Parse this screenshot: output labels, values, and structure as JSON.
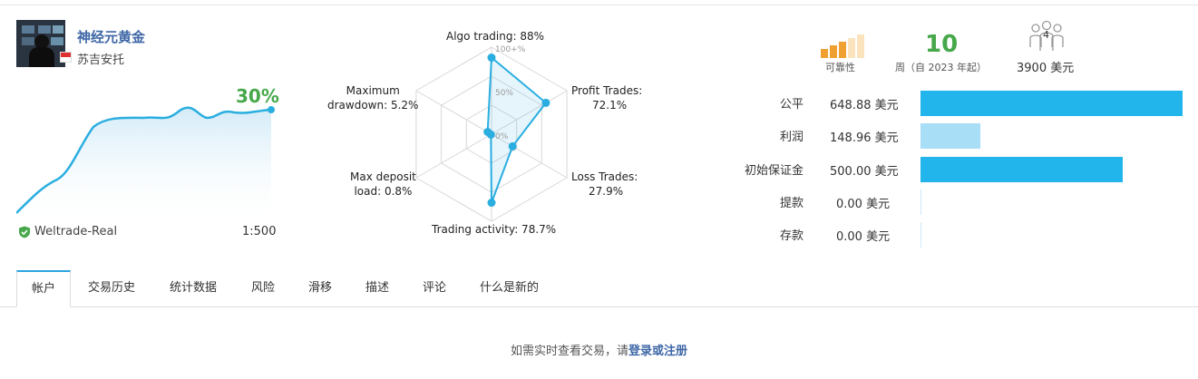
{
  "signal": {
    "name": "神经元黄金",
    "author": "苏吉安托",
    "growth": "30%",
    "broker": "Weltrade-Real",
    "leverage": "1:500"
  },
  "radar": {
    "algo_trading": "Algo trading: 88%",
    "profit_trades_line1": "Profit Trades:",
    "profit_trades_line2": "72.1%",
    "loss_trades_line1": "Loss Trades:",
    "loss_trades_line2": "27.9%",
    "trading_activity": "Trading activity: 78.7%",
    "max_deposit_line1": "Max deposit",
    "max_deposit_line2": "load: 0.8%",
    "max_drawdown_line1": "Maximum",
    "max_drawdown_line2": "drawdown: 5.2%",
    "scale_100": "100+%",
    "scale_50": "50%",
    "scale_0": "0%",
    "values": {
      "algo_trading": 88,
      "profit_trades": 72.1,
      "loss_trades": 27.9,
      "trading_activity": 78.7,
      "max_deposit_load": 0.8,
      "max_drawdown": 5.2
    }
  },
  "stats": {
    "reliability_label": "可靠性",
    "weeks_value": "10",
    "weeks_label": "周（自 2023 年起）",
    "subscribers": "4",
    "price": "3900 美元"
  },
  "finance": [
    {
      "label": "公平",
      "value": "648.88 美元",
      "fill": 1.0,
      "color": "#22b5ec"
    },
    {
      "label": "利润",
      "value": "148.96 美元",
      "fill": 0.23,
      "color": "#a8def6"
    },
    {
      "label": "初始保证金",
      "value": "500.00 美元",
      "fill": 0.77,
      "color": "#22b5ec"
    },
    {
      "label": "提款",
      "value": "0.00 美元",
      "fill": 0.0,
      "color": "#a8def6"
    },
    {
      "label": "存款",
      "value": "0.00 美元",
      "fill": 0.0,
      "color": "#a8def6"
    }
  ],
  "tabs": [
    {
      "label": "帐户",
      "active": true
    },
    {
      "label": "交易历史",
      "active": false
    },
    {
      "label": "统计数据",
      "active": false
    },
    {
      "label": "风险",
      "active": false
    },
    {
      "label": "滑移",
      "active": false
    },
    {
      "label": "描述",
      "active": false
    },
    {
      "label": "评论",
      "active": false
    },
    {
      "label": "什么是新的",
      "active": false
    }
  ],
  "login": {
    "prefix": "如需实时查看交易，请",
    "login_link": "登录",
    "or": "或",
    "register_link": "注册"
  },
  "colors": {
    "accent_blue": "#22b5ec",
    "accent_green": "#46a84b",
    "link_blue": "#3e67a6",
    "rating_orange": "#f0a030"
  }
}
